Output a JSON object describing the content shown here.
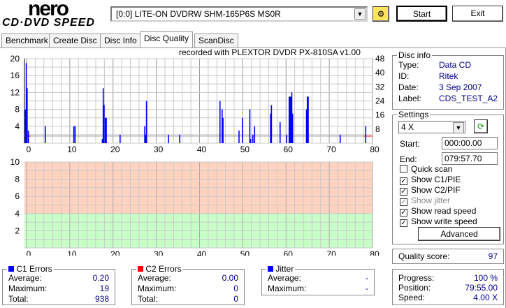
{
  "app": {
    "logo_top": "nero",
    "logo_bottom": "CD·DVD SPEED"
  },
  "toolbar": {
    "drive": "[0:0]  LITE-ON DVDRW SHM-165P6S MS0R",
    "start": "Start",
    "exit": "Exit"
  },
  "tabs": [
    "Benchmark",
    "Create Disc",
    "Disc Info",
    "Disc Quality",
    "ScanDisc"
  ],
  "recorded": "recorded with PLEXTOR DVDR   PX-810SA  v1.00",
  "disc_info": {
    "title": "Disc info",
    "rows": [
      [
        "Type:",
        "Data CD"
      ],
      [
        "ID:",
        "Ritek"
      ],
      [
        "Date:",
        "3 Sep 2007"
      ],
      [
        "Label:",
        "CDS_TEST_A2"
      ]
    ]
  },
  "settings": {
    "title": "Settings",
    "speed": "4 X",
    "start_label": "Start:",
    "start": "000:00.00",
    "end_label": "End:",
    "end": "079:57.70",
    "checks": [
      {
        "label": "Quick scan",
        "checked": false,
        "disabled": false
      },
      {
        "label": "Show C1/PIE",
        "checked": true,
        "disabled": false
      },
      {
        "label": "Show C2/PIF",
        "checked": true,
        "disabled": false
      },
      {
        "label": "Show jitter",
        "checked": true,
        "disabled": true
      },
      {
        "label": "Show read speed",
        "checked": true,
        "disabled": false
      },
      {
        "label": "Show write speed",
        "checked": true,
        "disabled": false
      }
    ],
    "advanced": "Advanced"
  },
  "quality": {
    "label": "Quality score:",
    "value": "97"
  },
  "progress": {
    "rows": [
      [
        "Progress:",
        "100 %"
      ],
      [
        "Position:",
        "79:55.00"
      ],
      [
        "Speed:",
        "4.00 X"
      ]
    ]
  },
  "c1": {
    "title": "C1 Errors",
    "color": "#0000ff",
    "rows": [
      [
        "Average:",
        "0.20"
      ],
      [
        "Maximum:",
        "19"
      ],
      [
        "Total:",
        "938"
      ]
    ]
  },
  "c2": {
    "title": "C2 Errors",
    "color": "#ff0000",
    "rows": [
      [
        "Average:",
        "0.00"
      ],
      [
        "Maximum:",
        "0"
      ],
      [
        "Total:",
        "0"
      ]
    ]
  },
  "jitter": {
    "title": "Jitter",
    "color": "#0000ff",
    "rows": [
      [
        "Average:",
        "-"
      ],
      [
        "Maximum:",
        "-"
      ]
    ]
  },
  "chart_data": [
    {
      "type": "bar",
      "title": "C1 errors",
      "ylim": [
        0,
        20
      ],
      "y2lim": [
        0,
        48
      ],
      "xlim": [
        0,
        80
      ],
      "yticks": [
        "20",
        "16",
        "12",
        "8",
        "4"
      ],
      "y2ticks": [
        "48",
        "40",
        "32",
        "24",
        "16",
        "8"
      ],
      "xticks": [
        "0",
        "10",
        "20",
        "30",
        "40",
        "50",
        "60",
        "70",
        "80"
      ],
      "c1": [
        [
          -0.4,
          8
        ],
        [
          -0.2,
          19
        ],
        [
          0,
          13
        ],
        [
          0.3,
          3
        ],
        [
          4.2,
          4
        ],
        [
          10.8,
          4
        ],
        [
          11.1,
          4
        ],
        [
          17.4,
          1
        ],
        [
          17.6,
          13
        ],
        [
          17.8,
          9
        ],
        [
          18.1,
          6
        ],
        [
          18.3,
          6
        ],
        [
          21.5,
          2
        ],
        [
          27.2,
          4
        ],
        [
          27.4,
          2
        ],
        [
          27.6,
          10
        ],
        [
          32.7,
          2
        ],
        [
          35.3,
          2
        ],
        [
          44.6,
          10
        ],
        [
          45.1,
          8
        ],
        [
          45.3,
          6
        ],
        [
          49,
          3
        ],
        [
          49.8,
          6
        ],
        [
          51.5,
          8
        ],
        [
          51.7,
          1
        ],
        [
          52.2,
          2
        ],
        [
          52.6,
          4
        ],
        [
          56.3,
          7
        ],
        [
          56.5,
          9
        ],
        [
          58.5,
          5
        ],
        [
          60,
          2
        ],
        [
          60.6,
          11
        ],
        [
          60.8,
          11
        ],
        [
          61,
          11
        ],
        [
          61.2,
          12
        ],
        [
          61.4,
          7
        ],
        [
          64.6,
          8
        ],
        [
          64.8,
          11
        ],
        [
          65,
          11
        ],
        [
          72.4,
          2
        ],
        [
          78.3,
          4
        ]
      ],
      "read_speed_x": 4
    },
    {
      "type": "area",
      "title": "Jitter",
      "ylim": [
        0,
        10
      ],
      "yticks": [
        "10",
        "8",
        "6",
        "4",
        "2"
      ],
      "xticks": [
        "0",
        "10",
        "20",
        "30",
        "40",
        "50",
        "60",
        "70",
        "80"
      ],
      "good_threshold": 4
    }
  ]
}
